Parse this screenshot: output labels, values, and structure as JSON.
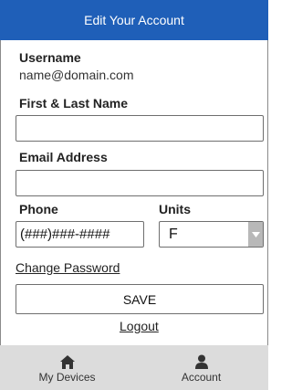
{
  "header": {
    "title": "Edit Your Account"
  },
  "username": {
    "label": "Username",
    "value": "name@domain.com"
  },
  "name_field": {
    "label": "First & Last Name",
    "value": ""
  },
  "email_field": {
    "label": "Email Address",
    "value": ""
  },
  "phone_field": {
    "label": "Phone",
    "value": "(###)###-####"
  },
  "units_field": {
    "label": "Units",
    "selected": "F"
  },
  "links": {
    "change_password": "Change Password",
    "logout": "Logout"
  },
  "save_button": {
    "label": "SAVE"
  },
  "tabbar": {
    "tabs": [
      {
        "label": "My Devices",
        "icon": "home-icon"
      },
      {
        "label": "Account",
        "icon": "person-icon"
      }
    ]
  },
  "colors": {
    "header_bg": "#1f5fb8",
    "tabbar_bg": "#dcdcdc"
  }
}
